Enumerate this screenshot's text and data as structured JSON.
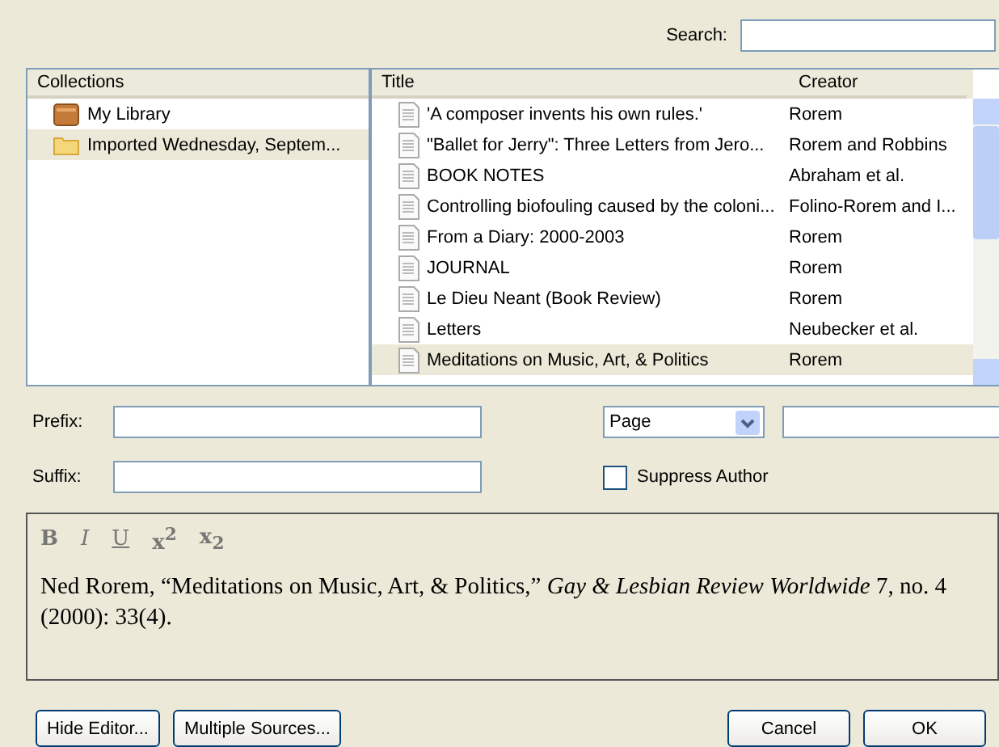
{
  "search": {
    "label": "Search:"
  },
  "collections": {
    "header": "Collections",
    "items": [
      {
        "label": "My Library",
        "kind": "library",
        "selected": false
      },
      {
        "label": "Imported Wednesday, Septem...",
        "kind": "folder",
        "selected": true
      }
    ]
  },
  "items": {
    "columns": [
      "Title",
      "Creator"
    ],
    "rows": [
      {
        "title": "'A composer invents his own rules.'",
        "creator": "Rorem",
        "selected": false
      },
      {
        "title": "\"Ballet for Jerry\": Three Letters from Jero...",
        "creator": "Rorem and Robbins",
        "selected": false
      },
      {
        "title": "BOOK NOTES",
        "creator": "Abraham et al.",
        "selected": false
      },
      {
        "title": "Controlling biofouling caused by the coloni...",
        "creator": "Folino-Rorem and I...",
        "selected": false
      },
      {
        "title": "From a Diary: 2000-2003",
        "creator": "Rorem",
        "selected": false
      },
      {
        "title": "JOURNAL",
        "creator": "Rorem",
        "selected": false
      },
      {
        "title": "Le Dieu Neant (Book Review)",
        "creator": "Rorem",
        "selected": false
      },
      {
        "title": "Letters",
        "creator": "Neubecker et al.",
        "selected": false
      },
      {
        "title": "Meditations on Music, Art, & Politics",
        "creator": "Rorem",
        "selected": true
      }
    ]
  },
  "prefix": {
    "label": "Prefix:"
  },
  "suffix": {
    "label": "Suffix:"
  },
  "locator": {
    "value": "Page"
  },
  "suppress_author": {
    "label": "Suppress Author",
    "checked": false
  },
  "format_buttons": [
    "B",
    "I",
    "U",
    "x$^{2}$",
    "x$_{2}$"
  ],
  "citation": "Ned Rorem, “Meditations on Music, Art, & Politics,” *Gay & Lesbian Review Worldwide* 7, no. 4 (2000): 33(4).",
  "buttons_left": [
    "Hide Editor...",
    "Multiple Sources..."
  ],
  "buttons_right": [
    "Cancel",
    "OK"
  ]
}
